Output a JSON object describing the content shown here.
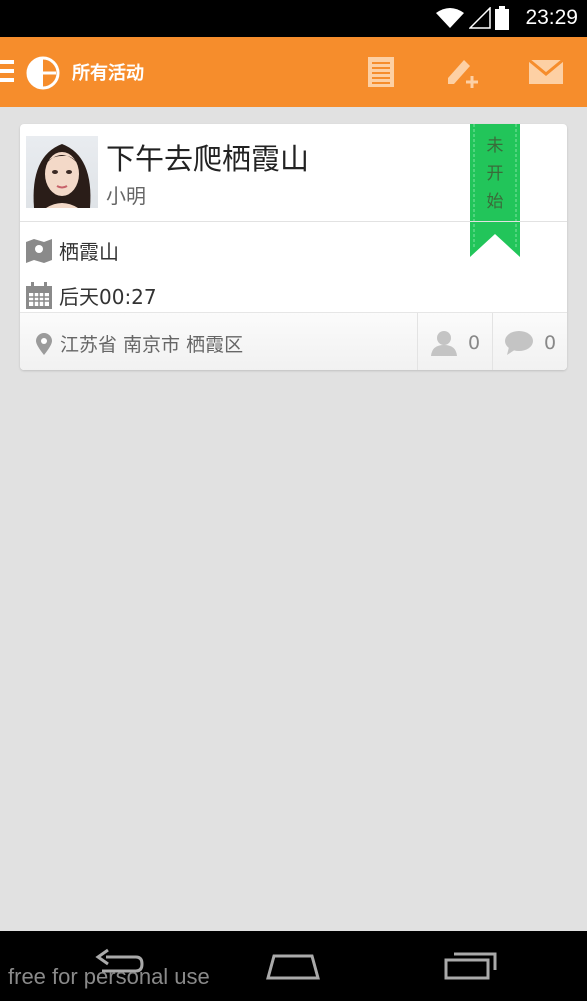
{
  "status_bar": {
    "time": "23:29"
  },
  "app_bar": {
    "title": "所有活动"
  },
  "activity": {
    "title": "下午去爬栖霞山",
    "organizer": "小明",
    "status": "未开始",
    "place": "栖霞山",
    "time": "后天00:27",
    "location": "江苏省 南京市 栖霞区",
    "participants": "0",
    "comments": "0"
  },
  "colors": {
    "accent": "#f68d2c",
    "ribbon": "#22c55a",
    "background": "#e1e1e1"
  },
  "icons": [
    "wifi-icon",
    "signal-icon",
    "battery-icon",
    "menu-icon",
    "logo-icon",
    "list-icon",
    "new-activity-icon",
    "mail-icon",
    "map-icon",
    "calendar-icon",
    "location-pin-icon",
    "person-icon",
    "comment-icon",
    "back-icon",
    "home-icon",
    "recent-apps-icon"
  ],
  "watermark": "free for personal use"
}
